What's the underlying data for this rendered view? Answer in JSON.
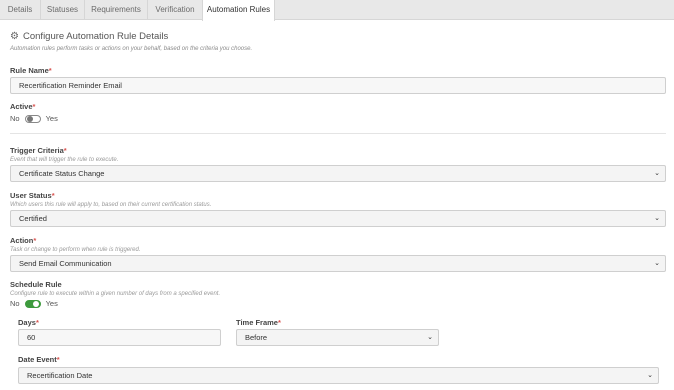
{
  "tabs": [
    {
      "label": "Details"
    },
    {
      "label": "Statuses"
    },
    {
      "label": "Requirements"
    },
    {
      "label": "Verification"
    },
    {
      "label": "Automation Rules"
    }
  ],
  "header": {
    "title": "Configure Automation Rule Details",
    "subtitle": "Automation rules perform tasks or actions on your behalf, based on the criteria you choose."
  },
  "rule_name": {
    "label": "Rule Name",
    "value": "Recertification Reminder Email"
  },
  "active": {
    "label": "Active",
    "no": "No",
    "yes": "Yes",
    "state": "off"
  },
  "trigger": {
    "label": "Trigger Criteria",
    "help": "Event that will trigger the rule to execute.",
    "value": "Certificate Status Change"
  },
  "user_status": {
    "label": "User Status",
    "help": "Which users this rule will apply to, based on their current certification status.",
    "value": "Certified"
  },
  "action": {
    "label": "Action",
    "help": "Task or change to perform when rule is triggered.",
    "value": "Send Email Communication"
  },
  "schedule": {
    "label": "Schedule Rule",
    "help": "Configure rule to execute within a given number of days from a specified event.",
    "no": "No",
    "yes": "Yes",
    "state": "on"
  },
  "days": {
    "label": "Days",
    "value": "60"
  },
  "time_frame": {
    "label": "Time Frame",
    "value": "Before"
  },
  "date_event": {
    "label": "Date Event",
    "value": "Recertification Date"
  },
  "required_mark": "*",
  "icons": {
    "settings": "gears-icon",
    "dropdown": "chevron-down-icon"
  }
}
